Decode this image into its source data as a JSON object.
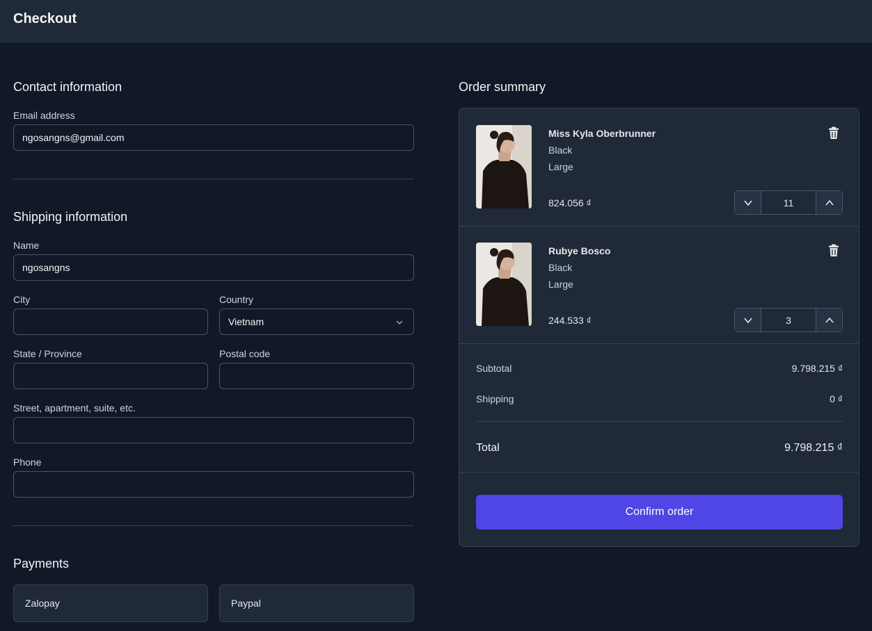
{
  "header": {
    "title": "Checkout"
  },
  "contact": {
    "title": "Contact information",
    "email_label": "Email address",
    "email_value": "ngosangns@gmail.com"
  },
  "shipping": {
    "title": "Shipping information",
    "name_label": "Name",
    "name_value": "ngosangns",
    "city_label": "City",
    "city_value": "",
    "country_label": "Country",
    "country_value": "Vietnam",
    "state_label": "State / Province",
    "state_value": "",
    "postal_label": "Postal code",
    "postal_value": "",
    "street_label": "Street, apartment, suite, etc.",
    "street_value": "",
    "phone_label": "Phone",
    "phone_value": ""
  },
  "payments": {
    "title": "Payments",
    "options": [
      "Zalopay",
      "Paypal"
    ]
  },
  "summary": {
    "title": "Order summary",
    "items": [
      {
        "name": "Miss Kyla Oberbrunner",
        "color": "Black",
        "size": "Large",
        "price": "824.056 ₫",
        "quantity": "11"
      },
      {
        "name": "Rubye Bosco",
        "color": "Black",
        "size": "Large",
        "price": "244.533 ₫",
        "quantity": "3"
      }
    ],
    "subtotal_label": "Subtotal",
    "subtotal_value": "9.798.215 ₫",
    "shipping_label": "Shipping",
    "shipping_value": "0 ₫",
    "total_label": "Total",
    "total_value": "9.798.215 ₫",
    "confirm_label": "Confirm order"
  },
  "colors": {
    "accent": "#4f46e5",
    "background": "#111827",
    "surface": "#1f2937"
  },
  "icons": [
    "trash-icon",
    "chevron-down-icon",
    "chevron-up-icon"
  ]
}
